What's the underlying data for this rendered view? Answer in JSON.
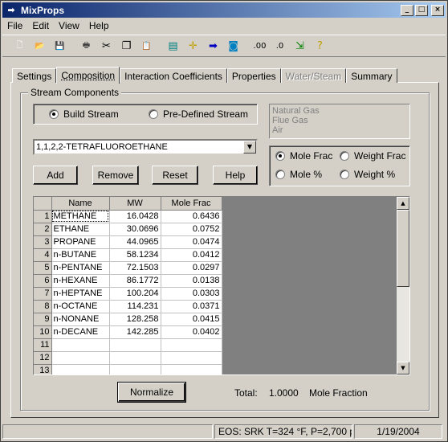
{
  "window": {
    "title": "MixProps",
    "app_icon": "arrow-icon"
  },
  "menu": [
    "File",
    "Edit",
    "View",
    "Help"
  ],
  "toolbar": {
    "buttons": [
      {
        "name": "new-icon",
        "glyph": "🗋",
        "color": "#ffffff"
      },
      {
        "name": "open-icon",
        "glyph": "📂",
        "color": "#e8c050"
      },
      {
        "name": "save-icon",
        "glyph": "💾",
        "color": "#000080"
      },
      {
        "name": "print-icon",
        "glyph": "🖶",
        "color": "#404040"
      },
      {
        "name": "cut-icon",
        "glyph": "✂",
        "color": "#000000"
      },
      {
        "name": "copy-icon",
        "glyph": "❐",
        "color": "#000000"
      },
      {
        "name": "paste-icon",
        "glyph": "📋",
        "color": "#806000"
      },
      {
        "name": "calculator-icon",
        "glyph": "▤",
        "color": "#008080"
      },
      {
        "name": "crosshair-icon",
        "glyph": "✛",
        "color": "#c0a000"
      },
      {
        "name": "arrow-right-icon",
        "glyph": "➡",
        "color": "#0000c0"
      },
      {
        "name": "tank-icon",
        "glyph": "◙",
        "color": "#0080c0"
      },
      {
        "name": "decimal-increase-icon",
        "glyph": ".00",
        "color": "#000000"
      },
      {
        "name": "decimal-decrease-icon",
        "glyph": ".0",
        "color": "#000000"
      },
      {
        "name": "export-icon",
        "glyph": "⇲",
        "color": "#008000"
      },
      {
        "name": "help-icon",
        "glyph": "?",
        "color": "#c0a000"
      }
    ]
  },
  "tabs": [
    {
      "label": "Settings",
      "active": false,
      "disabled": false
    },
    {
      "label": "Composition",
      "active": true,
      "disabled": false
    },
    {
      "label": "Interaction Coefficients",
      "active": false,
      "disabled": false
    },
    {
      "label": "Properties",
      "active": false,
      "disabled": false
    },
    {
      "label": "Water/Steam",
      "active": false,
      "disabled": true
    },
    {
      "label": "Summary",
      "active": false,
      "disabled": false
    }
  ],
  "stream": {
    "group_label": "Stream Components",
    "build_stream": "Build Stream",
    "predefined_stream": "Pre-Defined Stream",
    "predefined_list": [
      "Natural Gas",
      "Flue Gas",
      "Air"
    ],
    "component_select": "1,1,2,2-TETRAFLUOROETHANE",
    "basis": {
      "mole_frac": "Mole Frac",
      "weight_frac": "Weight Frac",
      "mole_pct": "Mole %",
      "weight_pct": "Weight %"
    },
    "buttons": {
      "add": "Add",
      "remove": "Remove",
      "reset": "Reset",
      "help": "Help",
      "normalize": "Normalize"
    }
  },
  "grid": {
    "headers": [
      "Name",
      "MW",
      "Mole Frac"
    ],
    "rows": [
      {
        "n": "1",
        "name": "METHANE",
        "mw": "16.0428",
        "frac": "0.6436"
      },
      {
        "n": "2",
        "name": "ETHANE",
        "mw": "30.0696",
        "frac": "0.0752"
      },
      {
        "n": "3",
        "name": "PROPANE",
        "mw": "44.0965",
        "frac": "0.0474"
      },
      {
        "n": "4",
        "name": "n-BUTANE",
        "mw": "58.1234",
        "frac": "0.0412"
      },
      {
        "n": "5",
        "name": "n-PENTANE",
        "mw": "72.1503",
        "frac": "0.0297"
      },
      {
        "n": "6",
        "name": "n-HEXANE",
        "mw": "86.1772",
        "frac": "0.0138"
      },
      {
        "n": "7",
        "name": "n-HEPTANE",
        "mw": "100.204",
        "frac": "0.0303"
      },
      {
        "n": "8",
        "name": "n-OCTANE",
        "mw": "114.231",
        "frac": "0.0371"
      },
      {
        "n": "9",
        "name": "n-NONANE",
        "mw": "128.258",
        "frac": "0.0415"
      },
      {
        "n": "10",
        "name": "n-DECANE",
        "mw": "142.285",
        "frac": "0.0402"
      },
      {
        "n": "11",
        "name": "",
        "mw": "",
        "frac": ""
      },
      {
        "n": "12",
        "name": "",
        "mw": "",
        "frac": ""
      },
      {
        "n": "13",
        "name": "",
        "mw": "",
        "frac": ""
      }
    ]
  },
  "totals": {
    "label": "Total:",
    "value": "1.0000",
    "unit": "Mole Fraction"
  },
  "status": {
    "pane1": "",
    "eos": "EOS: SRK T=324 °F, P=2,700 psia",
    "date": "1/19/2004"
  }
}
